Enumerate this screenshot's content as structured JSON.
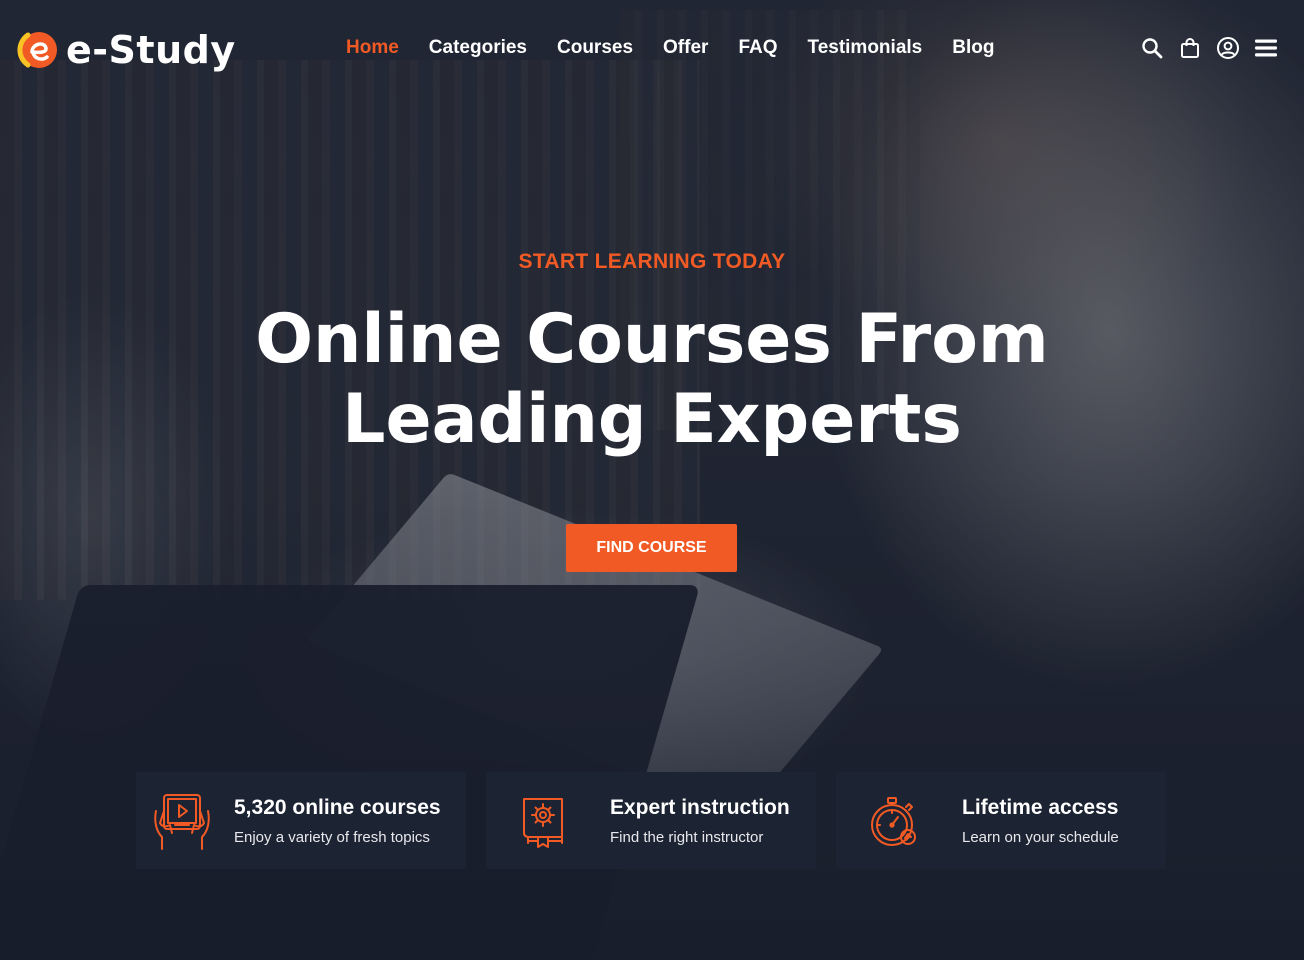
{
  "brand": {
    "name": "e-Study",
    "accent": "#f15a24",
    "logo_yellow": "#f7c325"
  },
  "nav": {
    "items": [
      {
        "label": "Home",
        "active": true
      },
      {
        "label": "Categories",
        "active": false
      },
      {
        "label": "Courses",
        "active": false
      },
      {
        "label": "Offer",
        "active": false
      },
      {
        "label": "FAQ",
        "active": false
      },
      {
        "label": "Testimonials",
        "active": false
      },
      {
        "label": "Blog",
        "active": false
      }
    ]
  },
  "header_icons": [
    "search-icon",
    "shopping-bag-icon",
    "user-account-icon",
    "hamburger-menu-icon"
  ],
  "hero": {
    "eyebrow": "START LEARNING TODAY",
    "headline_line1": "Online Courses From",
    "headline_line2": "Leading Experts",
    "cta_label": "FIND COURSE"
  },
  "features": [
    {
      "icon": "tablet-video-icon",
      "title": "5,320 online courses",
      "subtitle": "Enjoy a variety of fresh topics"
    },
    {
      "icon": "certificate-book-icon",
      "title": "Expert instruction",
      "subtitle": "Find the right instructor"
    },
    {
      "icon": "stopwatch-icon",
      "title": "Lifetime access",
      "subtitle": "Learn on your schedule"
    }
  ],
  "colors": {
    "card_bg": "#1c2333",
    "text": "#ffffff"
  }
}
